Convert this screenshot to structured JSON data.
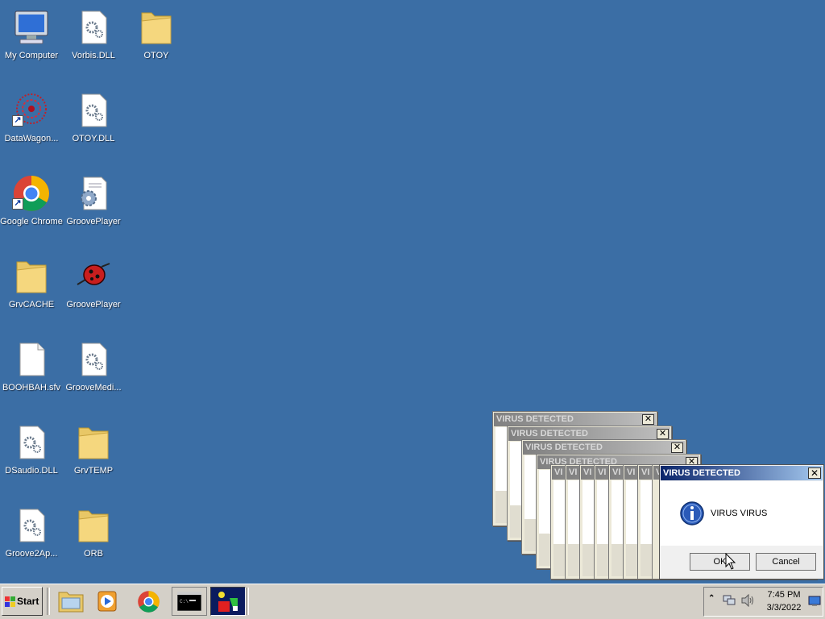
{
  "desktop_icons": [
    {
      "label": "My Computer"
    },
    {
      "label": "Vorbis.DLL"
    },
    {
      "label": "OTOY"
    },
    {
      "label": "DataWagon..."
    },
    {
      "label": "OTOY.DLL"
    },
    {
      "label": "Google Chrome"
    },
    {
      "label": "GroovePlayer"
    },
    {
      "label": "GrvCACHE"
    },
    {
      "label": "GroovePlayer"
    },
    {
      "label": "BOOHBAH.sfv"
    },
    {
      "label": "GrooveMedi..."
    },
    {
      "label": "DSaudio.DLL"
    },
    {
      "label": "GrvTEMP"
    },
    {
      "label": "Groove2Ap..."
    },
    {
      "label": "ORB"
    }
  ],
  "stacked_titles": [
    "VIRUS DETECTED",
    "VIRUS DETECTED",
    "VIRUS DETECTED",
    "VIRUS DETECTED"
  ],
  "stacked_small": [
    "VI",
    "VI",
    "VI",
    "VI",
    "VI",
    "VI",
    "VI",
    "VI"
  ],
  "dialog": {
    "title": "VIRUS DETECTED",
    "close_glyph": "✕",
    "message": "VIRUS VIRUS",
    "ok_label": "OK",
    "cancel_label": "Cancel"
  },
  "taskbar": {
    "start_label": "Start",
    "clock_time": "7:45 PM",
    "clock_date": "3/3/2022"
  },
  "colors": {
    "desktop": "#3b6ea5",
    "title_active": "#0a246a",
    "title_inactive": "#808080"
  }
}
